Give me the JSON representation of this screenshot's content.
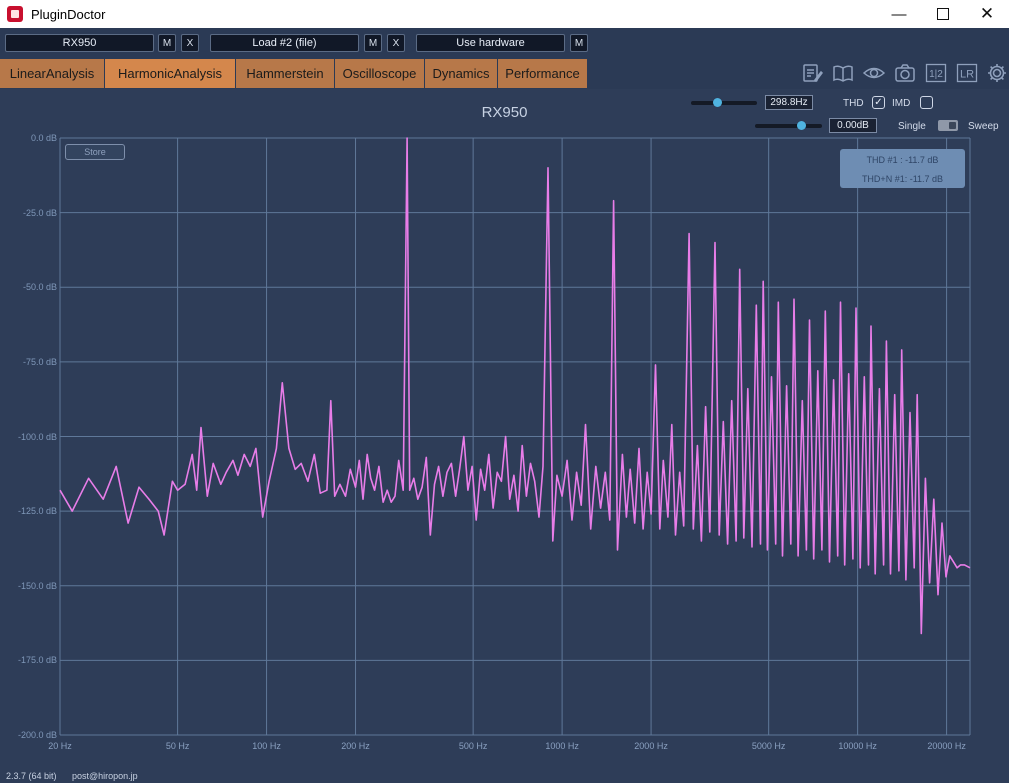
{
  "window": {
    "title": "PluginDoctor",
    "min_symbol": "—",
    "close_symbol": "✕"
  },
  "slots": {
    "slot1": {
      "name": "RX950",
      "m": "M",
      "x": "X"
    },
    "slot2": {
      "name": "Load #2 (file)",
      "m": "M",
      "x": "X"
    },
    "slot3": {
      "name": "Use hardware",
      "m": "M"
    }
  },
  "tabs": [
    {
      "label": "LinearAnalysis",
      "active": false
    },
    {
      "label": "HarmonicAnalysis",
      "active": true
    },
    {
      "label": "Hammerstein",
      "active": false
    },
    {
      "label": "Oscilloscope",
      "active": false
    },
    {
      "label": "Dynamics",
      "active": false
    },
    {
      "label": "Performance",
      "active": false
    }
  ],
  "toolbar": {
    "icons": [
      "notes-icon",
      "book-icon",
      "eye-icon",
      "camera-icon",
      "one-two-icon",
      "lr-icon",
      "gear-icon"
    ],
    "one_two_label": "1|2",
    "lr_label": "LR"
  },
  "analysis": {
    "title": "RX950",
    "frequency_value": "298.8Hz",
    "frequency_slider_level": 0.4,
    "gain_value": "0.00dB",
    "gain_slider_level": 0.68,
    "thd_label": "THD",
    "thd_checked": true,
    "imd_label": "IMD",
    "imd_checked": false,
    "single_label": "Single",
    "sweep_label": "Sweep",
    "store_label": "Store",
    "thd_readout": "THD #1 : -11.7 dB",
    "thdn_readout": "THD+N #1: -11.7 dB"
  },
  "chart_data": {
    "type": "line",
    "x_scale": "log",
    "xlim": [
      20,
      24000
    ],
    "ylim": [
      -200,
      0
    ],
    "y_ticks": [
      "0.0 dB",
      "-25.0 dB",
      "-50.0 dB",
      "-75.0 dB",
      "-100.0 dB",
      "-125.0 dB",
      "-150.0 dB",
      "-175.0 dB",
      "-200.0 dB"
    ],
    "x_ticks": [
      "20 Hz",
      "50 Hz",
      "100 Hz",
      "200 Hz",
      "500 Hz",
      "1000 Hz",
      "2000 Hz",
      "5000 Hz",
      "10000 Hz",
      "20000 Hz"
    ],
    "x_tick_values": [
      20,
      50,
      100,
      200,
      500,
      1000,
      2000,
      5000,
      10000,
      20000
    ],
    "grid": true,
    "line_color": "#e87de8",
    "series": [
      {
        "points": [
          [
            20,
            -118
          ],
          [
            22,
            -125
          ],
          [
            25,
            -114
          ],
          [
            28,
            -121
          ],
          [
            31,
            -110
          ],
          [
            34,
            -129
          ],
          [
            37,
            -117
          ],
          [
            40,
            -121
          ],
          [
            43,
            -125
          ],
          [
            45,
            -133
          ],
          [
            48,
            -115
          ],
          [
            50,
            -118
          ],
          [
            53,
            -116
          ],
          [
            56,
            -106
          ],
          [
            58,
            -118
          ],
          [
            60,
            -97
          ],
          [
            63,
            -120
          ],
          [
            66,
            -109
          ],
          [
            70,
            -116
          ],
          [
            73,
            -112
          ],
          [
            77,
            -108
          ],
          [
            80,
            -113
          ],
          [
            84,
            -106
          ],
          [
            88,
            -110
          ],
          [
            92,
            -104
          ],
          [
            97,
            -127
          ],
          [
            102,
            -115
          ],
          [
            108,
            -104
          ],
          [
            113,
            -82
          ],
          [
            119,
            -104
          ],
          [
            125,
            -111
          ],
          [
            131,
            -109
          ],
          [
            138,
            -115
          ],
          [
            145,
            -106
          ],
          [
            152,
            -119
          ],
          [
            160,
            -118
          ],
          [
            165,
            -88
          ],
          [
            170,
            -120
          ],
          [
            177,
            -116
          ],
          [
            185,
            -120
          ],
          [
            192,
            -111
          ],
          [
            200,
            -117
          ],
          [
            206,
            -108
          ],
          [
            212,
            -121
          ],
          [
            219,
            -106
          ],
          [
            225,
            -114
          ],
          [
            232,
            -118
          ],
          [
            240,
            -110
          ],
          [
            248,
            -122
          ],
          [
            256,
            -118
          ],
          [
            264,
            -122
          ],
          [
            272,
            -120
          ],
          [
            280,
            -108
          ],
          [
            290,
            -118
          ],
          [
            298.8,
            0
          ],
          [
            305,
            -118
          ],
          [
            315,
            -114
          ],
          [
            325,
            -121
          ],
          [
            336,
            -117
          ],
          [
            347,
            -107
          ],
          [
            358,
            -133
          ],
          [
            370,
            -116
          ],
          [
            382,
            -110
          ],
          [
            395,
            -120
          ],
          [
            408,
            -112
          ],
          [
            422,
            -109
          ],
          [
            436,
            -120
          ],
          [
            450,
            -111
          ],
          [
            465,
            -100
          ],
          [
            480,
            -118
          ],
          [
            496,
            -110
          ],
          [
            512,
            -128
          ],
          [
            530,
            -111
          ],
          [
            547,
            -118
          ],
          [
            565,
            -106
          ],
          [
            584,
            -124
          ],
          [
            603,
            -112
          ],
          [
            623,
            -115
          ],
          [
            644,
            -100
          ],
          [
            665,
            -121
          ],
          [
            687,
            -113
          ],
          [
            710,
            -125
          ],
          [
            733,
            -103
          ],
          [
            757,
            -120
          ],
          [
            782,
            -109
          ],
          [
            808,
            -115
          ],
          [
            835,
            -127
          ],
          [
            862,
            -110
          ],
          [
            896,
            -10
          ],
          [
            930,
            -135
          ],
          [
            960,
            -113
          ],
          [
            1000,
            -120
          ],
          [
            1040,
            -108
          ],
          [
            1080,
            -128
          ],
          [
            1120,
            -112
          ],
          [
            1160,
            -123
          ],
          [
            1200,
            -96
          ],
          [
            1250,
            -131
          ],
          [
            1300,
            -110
          ],
          [
            1350,
            -124
          ],
          [
            1400,
            -112
          ],
          [
            1450,
            -128
          ],
          [
            1494,
            -21
          ],
          [
            1540,
            -138
          ],
          [
            1600,
            -106
          ],
          [
            1650,
            -127
          ],
          [
            1700,
            -111
          ],
          [
            1760,
            -129
          ],
          [
            1820,
            -104
          ],
          [
            1880,
            -131
          ],
          [
            1940,
            -112
          ],
          [
            2000,
            -126
          ],
          [
            2070,
            -76
          ],
          [
            2140,
            -131
          ],
          [
            2200,
            -108
          ],
          [
            2280,
            -127
          ],
          [
            2350,
            -96
          ],
          [
            2420,
            -133
          ],
          [
            2500,
            -112
          ],
          [
            2580,
            -130
          ],
          [
            2690,
            -32
          ],
          [
            2780,
            -131
          ],
          [
            2870,
            -103
          ],
          [
            2960,
            -135
          ],
          [
            3060,
            -90
          ],
          [
            3160,
            -132
          ],
          [
            3290,
            -35
          ],
          [
            3400,
            -133
          ],
          [
            3510,
            -95
          ],
          [
            3630,
            -136
          ],
          [
            3750,
            -88
          ],
          [
            3880,
            -135
          ],
          [
            3990,
            -44
          ],
          [
            4120,
            -134
          ],
          [
            4250,
            -84
          ],
          [
            4390,
            -137
          ],
          [
            4540,
            -56
          ],
          [
            4690,
            -136
          ],
          [
            4790,
            -48
          ],
          [
            4950,
            -138
          ],
          [
            5110,
            -80
          ],
          [
            5280,
            -136
          ],
          [
            5390,
            -55
          ],
          [
            5570,
            -140
          ],
          [
            5750,
            -83
          ],
          [
            5940,
            -136
          ],
          [
            6090,
            -54
          ],
          [
            6290,
            -140
          ],
          [
            6500,
            -88
          ],
          [
            6710,
            -138
          ],
          [
            6870,
            -61
          ],
          [
            7100,
            -141
          ],
          [
            7330,
            -78
          ],
          [
            7570,
            -138
          ],
          [
            7770,
            -58
          ],
          [
            8030,
            -142
          ],
          [
            8290,
            -81
          ],
          [
            8560,
            -140
          ],
          [
            8750,
            -55
          ],
          [
            9040,
            -143
          ],
          [
            9330,
            -79
          ],
          [
            9640,
            -141
          ],
          [
            9870,
            -57
          ],
          [
            10200,
            -144
          ],
          [
            10530,
            -80
          ],
          [
            10880,
            -143
          ],
          [
            11100,
            -63
          ],
          [
            11470,
            -146
          ],
          [
            11850,
            -84
          ],
          [
            12240,
            -143
          ],
          [
            12510,
            -68
          ],
          [
            12920,
            -146
          ],
          [
            13350,
            -86
          ],
          [
            13790,
            -145
          ],
          [
            14100,
            -71
          ],
          [
            14560,
            -148
          ],
          [
            15040,
            -92
          ],
          [
            15540,
            -144
          ],
          [
            15900,
            -86
          ],
          [
            16420,
            -166
          ],
          [
            16960,
            -114
          ],
          [
            17520,
            -149
          ],
          [
            18100,
            -121
          ],
          [
            18700,
            -153
          ],
          [
            19300,
            -129
          ],
          [
            19900,
            -147
          ],
          [
            20500,
            -140
          ],
          [
            21100,
            -142
          ],
          [
            21700,
            -144
          ],
          [
            22300,
            -143
          ],
          [
            23000,
            -143
          ],
          [
            24000,
            -144
          ]
        ]
      }
    ]
  },
  "status": {
    "version": "2.3.7 (64 bit)",
    "email": "post@hiropon.jp"
  }
}
